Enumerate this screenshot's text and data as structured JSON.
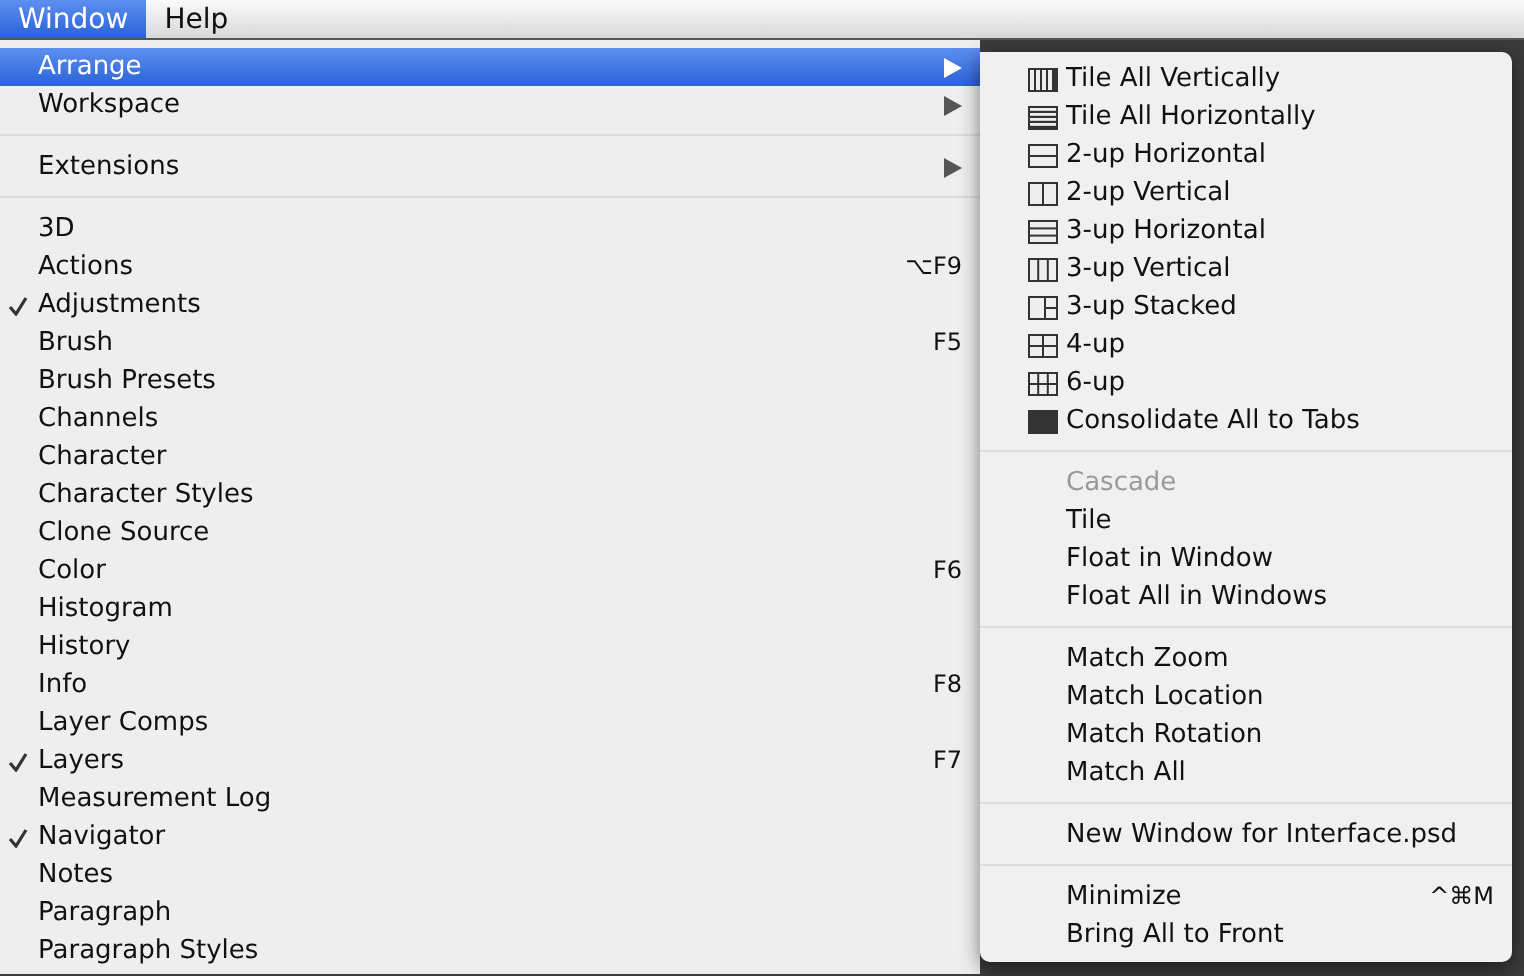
{
  "menubar": [
    {
      "label": "Window",
      "selected": true
    },
    {
      "label": "Help",
      "selected": false
    }
  ],
  "menu": {
    "groups": [
      [
        {
          "label": "Arrange",
          "submenu": true,
          "checked": false,
          "selected": true
        },
        {
          "label": "Workspace",
          "submenu": true,
          "checked": false,
          "selected": false
        }
      ],
      [
        {
          "label": "Extensions",
          "submenu": true,
          "checked": false,
          "selected": false
        }
      ],
      [
        {
          "label": "3D",
          "submenu": false,
          "checked": false,
          "selected": false
        },
        {
          "label": "Actions",
          "shortcut": "⌥F9",
          "submenu": false,
          "checked": false,
          "selected": false
        },
        {
          "label": "Adjustments",
          "submenu": false,
          "checked": true,
          "selected": false
        },
        {
          "label": "Brush",
          "shortcut": "F5",
          "submenu": false,
          "checked": false,
          "selected": false
        },
        {
          "label": "Brush Presets",
          "submenu": false,
          "checked": false,
          "selected": false
        },
        {
          "label": "Channels",
          "submenu": false,
          "checked": false,
          "selected": false
        },
        {
          "label": "Character",
          "submenu": false,
          "checked": false,
          "selected": false
        },
        {
          "label": "Character Styles",
          "submenu": false,
          "checked": false,
          "selected": false
        },
        {
          "label": "Clone Source",
          "submenu": false,
          "checked": false,
          "selected": false
        },
        {
          "label": "Color",
          "shortcut": "F6",
          "submenu": false,
          "checked": false,
          "selected": false
        },
        {
          "label": "Histogram",
          "submenu": false,
          "checked": false,
          "selected": false
        },
        {
          "label": "History",
          "submenu": false,
          "checked": false,
          "selected": false
        },
        {
          "label": "Info",
          "shortcut": "F8",
          "submenu": false,
          "checked": false,
          "selected": false
        },
        {
          "label": "Layer Comps",
          "submenu": false,
          "checked": false,
          "selected": false
        },
        {
          "label": "Layers",
          "shortcut": "F7",
          "submenu": false,
          "checked": true,
          "selected": false
        },
        {
          "label": "Measurement Log",
          "submenu": false,
          "checked": false,
          "selected": false
        },
        {
          "label": "Navigator",
          "submenu": false,
          "checked": true,
          "selected": false
        },
        {
          "label": "Notes",
          "submenu": false,
          "checked": false,
          "selected": false
        },
        {
          "label": "Paragraph",
          "submenu": false,
          "checked": false,
          "selected": false
        },
        {
          "label": "Paragraph Styles",
          "submenu": false,
          "checked": false,
          "selected": false
        }
      ]
    ]
  },
  "submenu": {
    "groups": [
      [
        {
          "label": "Tile All Vertically",
          "kind": "with-icon",
          "disabled": false
        },
        {
          "label": "Tile All Horizontally",
          "kind": "with-icon",
          "disabled": false
        },
        {
          "label": "2-up Horizontal",
          "kind": "with-icon",
          "disabled": false
        },
        {
          "label": "2-up Vertical",
          "kind": "with-icon",
          "disabled": false
        },
        {
          "label": "3-up Horizontal",
          "kind": "with-icon",
          "disabled": false
        },
        {
          "label": "3-up Vertical",
          "kind": "with-icon",
          "disabled": false
        },
        {
          "label": "3-up Stacked",
          "kind": "with-icon",
          "disabled": false
        },
        {
          "label": "4-up",
          "kind": "with-icon",
          "disabled": false
        },
        {
          "label": "6-up",
          "kind": "with-icon",
          "disabled": false
        },
        {
          "label": "Consolidate All to Tabs",
          "kind": "with-icon",
          "disabled": false
        }
      ],
      [
        {
          "label": "Cascade",
          "kind": "plain",
          "disabled": true
        },
        {
          "label": "Tile",
          "kind": "plain",
          "disabled": false
        },
        {
          "label": "Float in Window",
          "kind": "plain",
          "disabled": false
        },
        {
          "label": "Float All in Windows",
          "kind": "plain",
          "disabled": false
        }
      ],
      [
        {
          "label": "Match Zoom",
          "kind": "plain",
          "disabled": false
        },
        {
          "label": "Match Location",
          "kind": "plain",
          "disabled": false
        },
        {
          "label": "Match Rotation",
          "kind": "plain",
          "disabled": false
        },
        {
          "label": "Match All",
          "kind": "plain",
          "disabled": false
        }
      ],
      [
        {
          "label": "New Window for Interface.psd",
          "kind": "plain",
          "disabled": false
        }
      ],
      [
        {
          "label": "Minimize",
          "shortcut": "^⌘M",
          "kind": "plain",
          "disabled": false
        },
        {
          "label": "Bring All to Front",
          "kind": "plain",
          "disabled": false
        }
      ]
    ]
  }
}
